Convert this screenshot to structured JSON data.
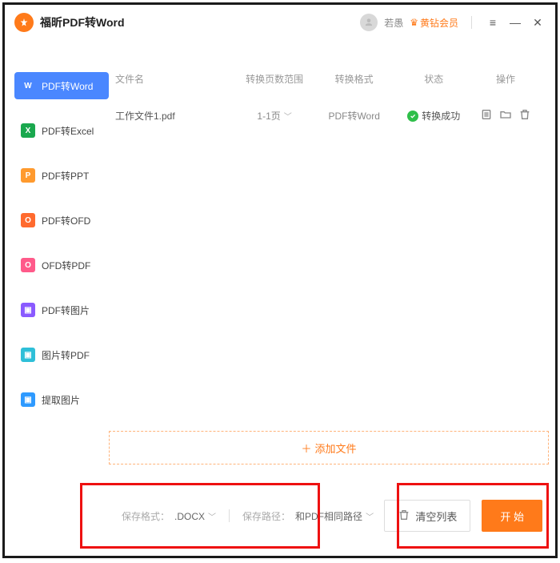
{
  "titlebar": {
    "app_title": "福昕PDF转Word",
    "user_name": "若愚",
    "member_label": "黄钻会员"
  },
  "sidebar": {
    "items": [
      {
        "icon_bg": "#4a87ff",
        "icon_char": "W",
        "label": "PDF转Word",
        "active": true
      },
      {
        "icon_bg": "#1aa84e",
        "icon_char": "X",
        "label": "PDF转Excel"
      },
      {
        "icon_bg": "#ff9a2e",
        "icon_char": "P",
        "label": "PDF转PPT"
      },
      {
        "icon_bg": "#ff6a2e",
        "icon_char": "O",
        "label": "PDF转OFD"
      },
      {
        "icon_bg": "#ff5a8a",
        "icon_char": "O",
        "label": "OFD转PDF"
      },
      {
        "icon_bg": "#8a5aff",
        "icon_char": "▣",
        "label": "PDF转图片"
      },
      {
        "icon_bg": "#2ebfd8",
        "icon_char": "▣",
        "label": "图片转PDF"
      },
      {
        "icon_bg": "#2e9aff",
        "icon_char": "▣",
        "label": "提取图片"
      }
    ]
  },
  "table": {
    "headers": {
      "name": "文件名",
      "pages": "转换页数范围",
      "format": "转换格式",
      "status": "状态",
      "ops": "操作"
    },
    "rows": [
      {
        "name": "工作文件1.pdf",
        "pages": "1-1页",
        "format": "PDF转Word",
        "status": "转换成功"
      }
    ]
  },
  "add_file_label": "添加文件",
  "footer": {
    "save_format_label": "保存格式：",
    "save_format_value": ".DOCX",
    "save_path_label": "保存路径：",
    "save_path_value": "和PDF相同路径",
    "clear_label": "清空列表",
    "start_label": "开 始"
  }
}
